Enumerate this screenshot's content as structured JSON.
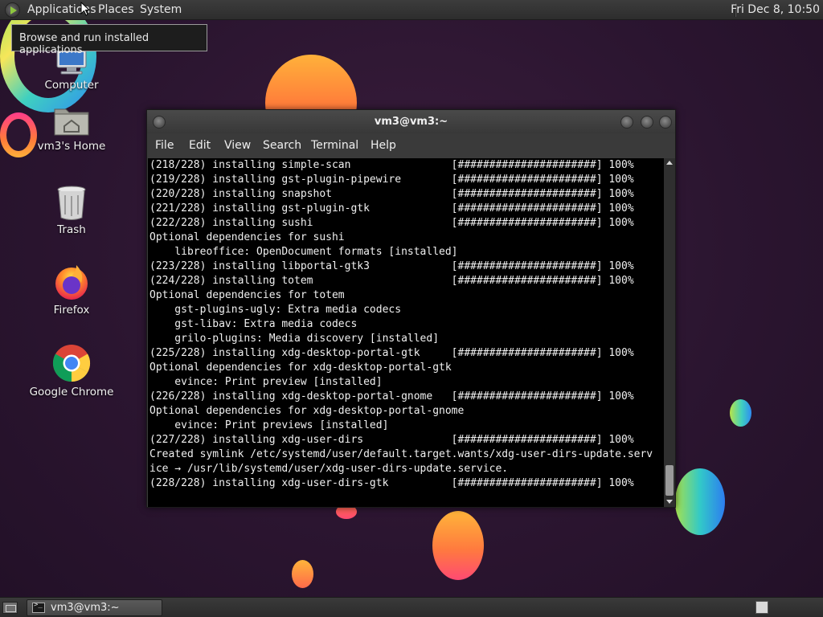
{
  "top_panel": {
    "menus": [
      "Applications",
      "Places",
      "System"
    ],
    "clock": "Fri Dec  8, 10:50"
  },
  "tooltip": "Browse and run installed applications",
  "desktop_icons": [
    {
      "label": "Computer",
      "icon": "computer-icon"
    },
    {
      "label": "vm3's Home",
      "icon": "home-folder-icon"
    },
    {
      "label": "Trash",
      "icon": "trash-icon"
    },
    {
      "label": "Firefox",
      "icon": "firefox-icon"
    },
    {
      "label": "Google Chrome",
      "icon": "chrome-icon"
    }
  ],
  "terminal": {
    "title": "vm3@vm3:~",
    "menu": [
      "File",
      "Edit",
      "View",
      "Search",
      "Terminal",
      "Help"
    ],
    "lines": [
      "(218/228) installing simple-scan                [######################] 100%",
      "(219/228) installing gst-plugin-pipewire        [######################] 100%",
      "(220/228) installing snapshot                   [######################] 100%",
      "(221/228) installing gst-plugin-gtk             [######################] 100%",
      "(222/228) installing sushi                      [######################] 100%",
      "Optional dependencies for sushi",
      "    libreoffice: OpenDocument formats [installed]",
      "(223/228) installing libportal-gtk3             [######################] 100%",
      "(224/228) installing totem                      [######################] 100%",
      "Optional dependencies for totem",
      "    gst-plugins-ugly: Extra media codecs",
      "    gst-libav: Extra media codecs",
      "    grilo-plugins: Media discovery [installed]",
      "(225/228) installing xdg-desktop-portal-gtk     [######################] 100%",
      "Optional dependencies for xdg-desktop-portal-gtk",
      "    evince: Print preview [installed]",
      "(226/228) installing xdg-desktop-portal-gnome   [######################] 100%",
      "Optional dependencies for xdg-desktop-portal-gnome",
      "    evince: Print previews [installed]",
      "(227/228) installing xdg-user-dirs              [######################] 100%",
      "Created symlink /etc/systemd/user/default.target.wants/xdg-user-dirs-update.serv",
      "ice → /usr/lib/systemd/user/xdg-user-dirs-update.service.",
      "(228/228) installing xdg-user-dirs-gtk          [######################] 100%",
      ""
    ]
  },
  "taskbar": {
    "task_label": "vm3@vm3:~"
  }
}
